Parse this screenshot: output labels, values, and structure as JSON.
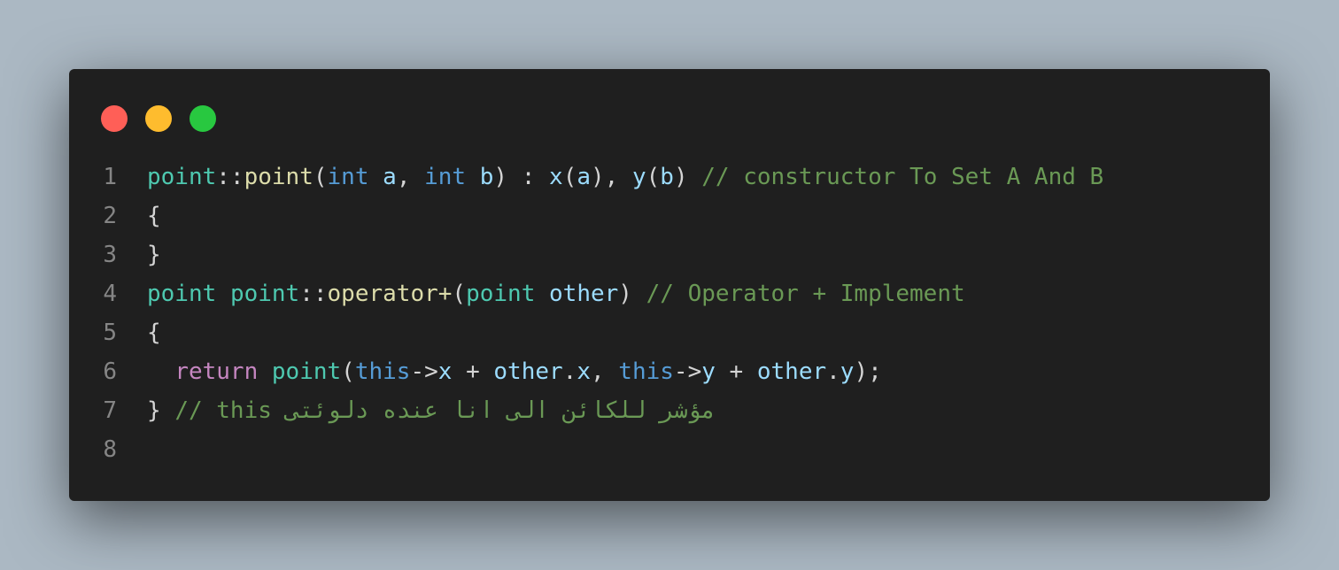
{
  "window": {
    "controls": [
      "close",
      "minimize",
      "maximize"
    ],
    "background": "#1f1f1f"
  },
  "editor": {
    "lines": [
      {
        "number": "1",
        "tokens": [
          {
            "t": "point",
            "c": "type"
          },
          {
            "t": "::",
            "c": "punc"
          },
          {
            "t": "point",
            "c": "fn"
          },
          {
            "t": "(",
            "c": "punc"
          },
          {
            "t": "int",
            "c": "kw"
          },
          {
            "t": " ",
            "c": "punc"
          },
          {
            "t": "a",
            "c": "var"
          },
          {
            "t": ", ",
            "c": "punc"
          },
          {
            "t": "int",
            "c": "kw"
          },
          {
            "t": " ",
            "c": "punc"
          },
          {
            "t": "b",
            "c": "var"
          },
          {
            "t": ") : ",
            "c": "punc"
          },
          {
            "t": "x",
            "c": "var"
          },
          {
            "t": "(",
            "c": "punc"
          },
          {
            "t": "a",
            "c": "var"
          },
          {
            "t": "), ",
            "c": "punc"
          },
          {
            "t": "y",
            "c": "var"
          },
          {
            "t": "(",
            "c": "punc"
          },
          {
            "t": "b",
            "c": "var"
          },
          {
            "t": ") ",
            "c": "punc"
          },
          {
            "t": "// constructor To Set A And B",
            "c": "cmt"
          }
        ]
      },
      {
        "number": "2",
        "tokens": [
          {
            "t": "{",
            "c": "punc"
          }
        ]
      },
      {
        "number": "3",
        "tokens": [
          {
            "t": "}",
            "c": "punc"
          }
        ]
      },
      {
        "number": "4",
        "tokens": [
          {
            "t": "point",
            "c": "type"
          },
          {
            "t": " ",
            "c": "punc"
          },
          {
            "t": "point",
            "c": "type"
          },
          {
            "t": "::",
            "c": "punc"
          },
          {
            "t": "operator+",
            "c": "fn"
          },
          {
            "t": "(",
            "c": "punc"
          },
          {
            "t": "point",
            "c": "type"
          },
          {
            "t": " ",
            "c": "punc"
          },
          {
            "t": "other",
            "c": "var"
          },
          {
            "t": ") ",
            "c": "punc"
          },
          {
            "t": "// Operator + Implement",
            "c": "cmt"
          }
        ]
      },
      {
        "number": "5",
        "tokens": [
          {
            "t": "{",
            "c": "punc"
          }
        ]
      },
      {
        "number": "6",
        "tokens": [
          {
            "t": "  ",
            "c": "punc"
          },
          {
            "t": "return",
            "c": "ctrl"
          },
          {
            "t": " ",
            "c": "punc"
          },
          {
            "t": "point",
            "c": "type"
          },
          {
            "t": "(",
            "c": "punc"
          },
          {
            "t": "this",
            "c": "kw"
          },
          {
            "t": "->",
            "c": "punc"
          },
          {
            "t": "x",
            "c": "var"
          },
          {
            "t": " + ",
            "c": "punc"
          },
          {
            "t": "other",
            "c": "var"
          },
          {
            "t": ".",
            "c": "punc"
          },
          {
            "t": "x",
            "c": "var"
          },
          {
            "t": ", ",
            "c": "punc"
          },
          {
            "t": "this",
            "c": "kw"
          },
          {
            "t": "->",
            "c": "punc"
          },
          {
            "t": "y",
            "c": "var"
          },
          {
            "t": " + ",
            "c": "punc"
          },
          {
            "t": "other",
            "c": "var"
          },
          {
            "t": ".",
            "c": "punc"
          },
          {
            "t": "y",
            "c": "var"
          },
          {
            "t": ");",
            "c": "punc"
          }
        ]
      },
      {
        "number": "7",
        "tokens": [
          {
            "t": "} ",
            "c": "punc"
          },
          {
            "t": "// this مؤشر للكائن الى انا عنده دلوئتى",
            "c": "cmt"
          }
        ]
      },
      {
        "number": "8",
        "tokens": []
      }
    ]
  },
  "theme": {
    "page_background": "#abb8c3",
    "line_number": "#858585",
    "punc": "#d4d4d4",
    "type": "#4ec9b0",
    "fn": "#dcdcaa",
    "kw": "#569cd6",
    "var": "#9cdcfe",
    "ctrl": "#c586c0",
    "cmt": "#6a9955"
  }
}
